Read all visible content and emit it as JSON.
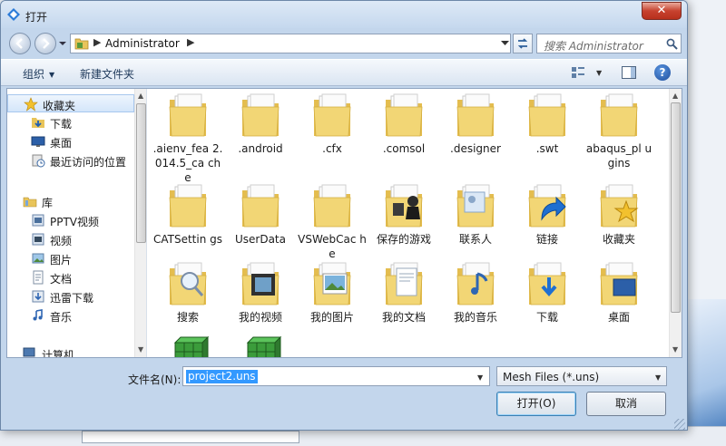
{
  "window": {
    "title": "打开"
  },
  "address": {
    "crumb": "Administrator"
  },
  "search": {
    "placeholder": "搜索 Administrator"
  },
  "toolbar": {
    "organize": "组织",
    "new_folder": "新建文件夹"
  },
  "nav": {
    "items": [
      {
        "label": "收藏夹",
        "icon": "star-icon"
      },
      {
        "label": "下载",
        "icon": "download-folder-icon"
      },
      {
        "label": "桌面",
        "icon": "desktop-icon"
      },
      {
        "label": "最近访问的位置",
        "icon": "recent-places-icon"
      },
      {
        "label": "库",
        "icon": "library-icon"
      },
      {
        "label": "PPTV视频",
        "icon": "video-library-icon"
      },
      {
        "label": "视频",
        "icon": "video-library-icon"
      },
      {
        "label": "图片",
        "icon": "pictures-library-icon"
      },
      {
        "label": "文档",
        "icon": "documents-library-icon"
      },
      {
        "label": "迅雷下载",
        "icon": "download-library-icon"
      },
      {
        "label": "音乐",
        "icon": "music-library-icon"
      },
      {
        "label": "计算机",
        "icon": "computer-icon"
      }
    ]
  },
  "files": [
    {
      "name": ".aienv_fea2.014.5_cache",
      "display": ".aienv_fea\n2.014.5_ca\nche",
      "icon": "folder-icon"
    },
    {
      "name": ".android",
      "display": ".android",
      "icon": "folder-icon"
    },
    {
      "name": ".cfx",
      "display": ".cfx",
      "icon": "folder-icon"
    },
    {
      "name": ".comsol",
      "display": ".comsol",
      "icon": "folder-icon"
    },
    {
      "name": ".designer",
      "display": ".designer",
      "icon": "folder-icon"
    },
    {
      "name": ".swt",
      "display": ".swt",
      "icon": "folder-icon"
    },
    {
      "name": "abaqus_plugins",
      "display": "abaqus_pl\nugins",
      "icon": "folder-icon"
    },
    {
      "name": "CATSettings",
      "display": "CATSettin\ngs",
      "icon": "folder-icon"
    },
    {
      "name": "UserData",
      "display": "UserData",
      "icon": "folder-icon"
    },
    {
      "name": "VSWebCache",
      "display": "VSWebCac\nhe",
      "icon": "folder-icon"
    },
    {
      "name": "保存的游戏",
      "display": "保存的游戏",
      "icon": "saved-games-folder-icon"
    },
    {
      "name": "联系人",
      "display": "联系人",
      "icon": "contacts-folder-icon"
    },
    {
      "name": "链接",
      "display": "链接",
      "icon": "links-folder-icon"
    },
    {
      "name": "收藏夹",
      "display": "收藏夹",
      "icon": "favorites-folder-icon"
    },
    {
      "name": "搜索",
      "display": "搜索",
      "icon": "searches-folder-icon"
    },
    {
      "name": "我的视频",
      "display": "我的视频",
      "icon": "my-videos-folder-icon"
    },
    {
      "name": "我的图片",
      "display": "我的图片",
      "icon": "my-pictures-folder-icon"
    },
    {
      "name": "我的文档",
      "display": "我的文档",
      "icon": "my-documents-folder-icon"
    },
    {
      "name": "我的音乐",
      "display": "我的音乐",
      "icon": "my-music-folder-icon"
    },
    {
      "name": "下载",
      "display": "下载",
      "icon": "downloads-folder-icon"
    },
    {
      "name": "桌面",
      "display": "桌面",
      "icon": "desktop-folder-icon"
    },
    {
      "name": "",
      "display": "",
      "icon": "mesh-file-icon"
    },
    {
      "name": "",
      "display": "",
      "icon": "mesh-file-icon"
    }
  ],
  "bottom": {
    "filename_label": "文件名(N):",
    "filename_value": "project2.uns",
    "filetype_value": "Mesh Files (*.uns)",
    "open_button": "打开(O)",
    "cancel_button": "取消"
  },
  "colors": {
    "folder": "#f2d675",
    "selection": "#3399ff",
    "close": "#c7422f"
  }
}
